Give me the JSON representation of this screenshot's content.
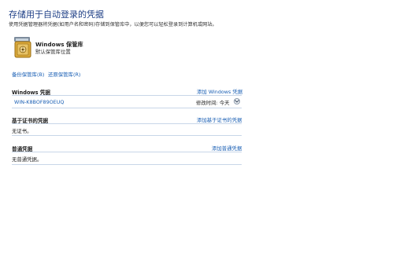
{
  "header": {
    "title": "存储用于自动登录的凭据",
    "description": "使用凭据管理器将凭据(如用户名和密码)存储到保管库中，以便您可以轻松登录到计算机或网站。"
  },
  "vault": {
    "name": "Windows 保管库",
    "location": "默认保管库位置"
  },
  "actions": {
    "backup": "备份保管库(B)",
    "restore": "还原保管库(R)"
  },
  "windows_credentials": {
    "title": "Windows 凭据",
    "add_link": "添加 Windows 凭据",
    "items": [
      {
        "name": "WIN-K8BOF89OEUQ",
        "modified": "修改时间: 今天"
      }
    ]
  },
  "certificate_credentials": {
    "title": "基于证书的凭据",
    "add_link": "添加基于证书的凭据",
    "empty": "无证书。"
  },
  "generic_credentials": {
    "title": "普通凭据",
    "add_link": "添加普通凭据",
    "empty": "无普通凭据。"
  },
  "colors": {
    "link": "#1a5fb4",
    "title": "#1e3f86",
    "rule": "#c8d6e8"
  },
  "icons": {
    "vault": "vault-safe-icon",
    "expand": "chevron-down-icon"
  }
}
